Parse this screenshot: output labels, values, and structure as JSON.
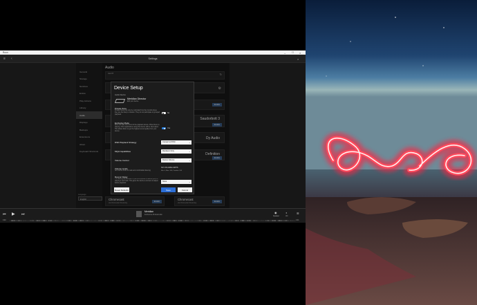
{
  "window": {
    "title": "Roon",
    "header_title": "Settings"
  },
  "nav": {
    "items": [
      {
        "label": "General"
      },
      {
        "label": "Storage"
      },
      {
        "label": "Services"
      },
      {
        "label": "Extras"
      },
      {
        "label": "Play Actions"
      },
      {
        "label": "Library"
      },
      {
        "label": "Audio"
      },
      {
        "label": "Displays"
      },
      {
        "label": "Backups"
      },
      {
        "label": "Extensions"
      },
      {
        "label": "About"
      },
      {
        "label": "Keyboard Shortcuts"
      }
    ],
    "active_index": 6,
    "language_label": "Language",
    "language_value": "English"
  },
  "main": {
    "title": "Audio",
    "rows": [
      {
        "text": "Hard B"
      },
      {
        "text": ""
      },
      {
        "text": ""
      },
      {
        "text": "Saudorbott 3"
      },
      {
        "text": "Dy Audio"
      },
      {
        "text": "Definition"
      }
    ],
    "enable_label": "Enable",
    "chromecast_cards": [
      {
        "name": "Chromecast",
        "sub": "via Chromecast Streaming"
      },
      {
        "name": "Chromecast",
        "sub": "via Chromecast Streaming"
      }
    ]
  },
  "dialog": {
    "title": "Device Setup",
    "section_label": "Audio Device",
    "device_name": "Meridian Director",
    "device_sub": "Edit your device",
    "private_zone": {
      "label": "Private Zone",
      "desc": "Private zones can only be controlled from the Control where they are the likely to transfer. They do not participate to grouped playback.",
      "toggle": "No"
    },
    "exclusive_mode": {
      "label": "Exclusive Mode",
      "desc": "Roon will take full control of the playback device. When Roon is playing, other applications using this device will be interrupted. This allows Roon to get the highest sound quality from your device.",
      "toggle": "Yes"
    },
    "dsd_strategy": {
      "label": "DSD Playback Strategy",
      "value": "Convert to PCM"
    },
    "mqa": {
      "label": "MQA Capabilities",
      "value": "Renderer Only"
    },
    "volume_control": {
      "label": "Volume Control",
      "value": "Device Volume"
    },
    "volume_limits": {
      "label": "Volume Limits",
      "desc": "Set volume limits for safe and comfortable listening",
      "value_main": "NO VOLUME LIMITS",
      "value_sub": "Min: 0, Max: 100, Comfort: 100"
    },
    "resync_delay": {
      "label": "Resync Delay",
      "desc": "This setting allows Roon to pre-roll a period of silence prior to playing a new track. This gives the device a moment to adjust before playback.",
      "value": "None"
    },
    "reset_label": "Reset Defaults",
    "save_label": "Save",
    "cancel_label": "Cancel"
  },
  "player": {
    "track_title": "Meridian",
    "track_sub": "Forthcome Products Etc.",
    "time_start": "0:00",
    "time_end": "4:31",
    "zone_label": "Speaker",
    "volume_label": "Vol"
  }
}
